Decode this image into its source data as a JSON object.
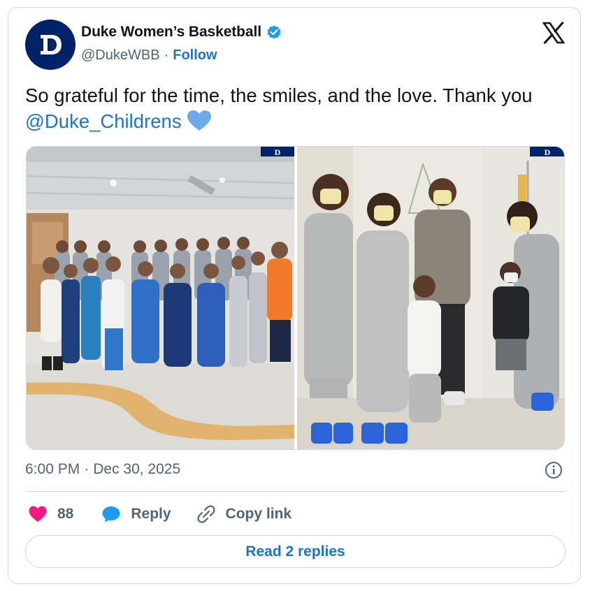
{
  "author": {
    "display_name": "Duke Women’s Basketball",
    "handle": "@DukeWBB",
    "separator": "·",
    "follow_label": "Follow",
    "avatar_letter": "D",
    "verified": true
  },
  "tweet": {
    "text_before": "So grateful for the time, the smiles, and the love. Thank you ",
    "mention": "@Duke_Childrens",
    "emoji": "blue-heart"
  },
  "media": {
    "images": [
      {
        "icon": "team-group-photo",
        "watermark": "D"
      },
      {
        "icon": "players-with-patient-photo",
        "watermark": "D"
      }
    ]
  },
  "meta": {
    "time": "6:00 PM",
    "separator": "·",
    "date": "Dec 30, 2025"
  },
  "actions": {
    "like_count": "88",
    "reply_label": "Reply",
    "copy_link_label": "Copy link"
  },
  "read_replies_label": "Read 2 replies",
  "colors": {
    "accent": "#1d74c8",
    "duke_blue": "#012169",
    "heart_red": "#f91880",
    "secondary_text": "#536471",
    "border": "#cfd9de"
  }
}
